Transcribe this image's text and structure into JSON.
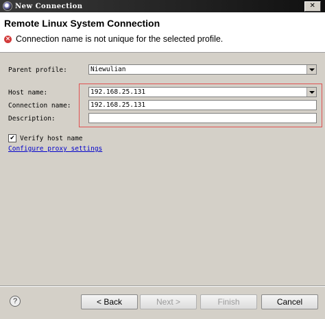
{
  "window": {
    "title": "New Connection",
    "close_glyph": "✕"
  },
  "header": {
    "title": "Remote Linux System Connection",
    "error_message": "Connection name is not unique for the selected profile."
  },
  "form": {
    "parent_profile": {
      "label": "Parent profile:",
      "value": "Niewulian"
    },
    "host_name": {
      "label": "Host name:",
      "value": "192.168.25.131"
    },
    "connection_name": {
      "label": "Connection name:",
      "value": "192.168.25.131"
    },
    "description": {
      "label": "Description:",
      "value": ""
    },
    "verify_host": {
      "label": "Verify host name",
      "checked": true,
      "check_glyph": "✔"
    },
    "proxy_link": "Configure proxy settings"
  },
  "footer": {
    "help_glyph": "?",
    "back": "< Back",
    "next": "Next >",
    "finish": "Finish",
    "cancel": "Cancel"
  },
  "colors": {
    "error": "#d23b3b",
    "highlight": "#e05050",
    "link": "#0000cc"
  }
}
